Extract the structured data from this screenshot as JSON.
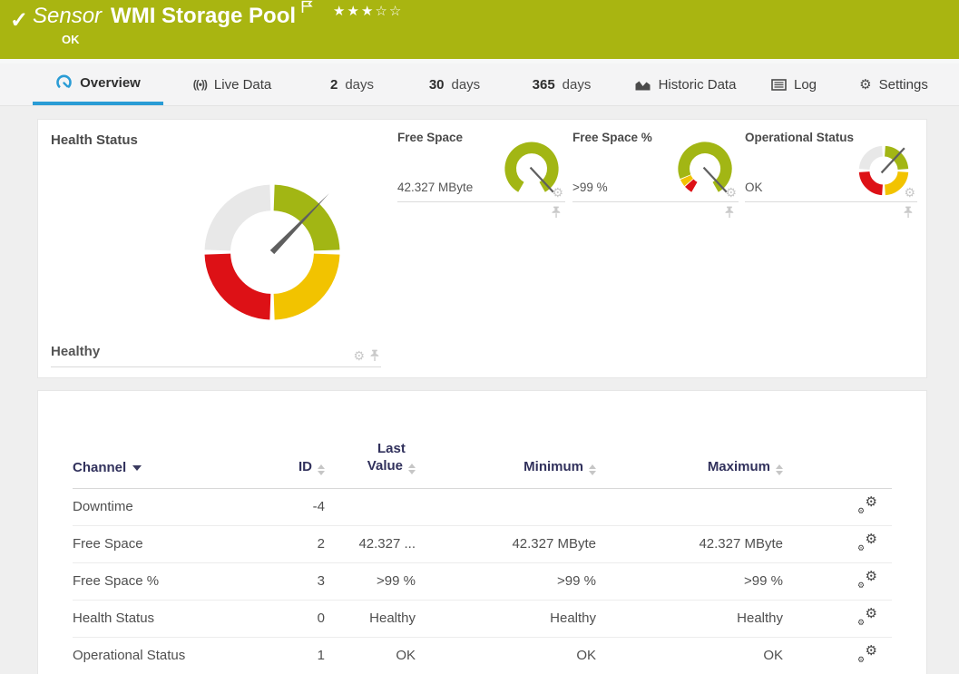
{
  "header": {
    "kind_label": "Sensor",
    "title": "WMI Storage Pool",
    "stars": "★★★☆☆",
    "status": "OK"
  },
  "tabs": [
    {
      "label": "Overview"
    },
    {
      "label": "Live Data"
    },
    {
      "num": "2",
      "label": "days"
    },
    {
      "num": "30",
      "label": "days"
    },
    {
      "num": "365",
      "label": "days"
    },
    {
      "label": "Historic Data"
    },
    {
      "label": "Log"
    },
    {
      "label": "Settings"
    }
  ],
  "gauges": {
    "health": {
      "title": "Health Status",
      "value": "Healthy"
    },
    "minis": [
      {
        "title": "Free Space",
        "value": "42.327 MByte"
      },
      {
        "title": "Free Space %",
        "value": ">99 %"
      },
      {
        "title": "Operational Status",
        "value": "OK"
      }
    ]
  },
  "table": {
    "header": {
      "channel": "Channel",
      "id": "ID",
      "last_line1": "Last",
      "last_line2": "Value",
      "minimum": "Minimum",
      "maximum": "Maximum"
    },
    "rows": [
      {
        "channel": "Downtime",
        "id": "-4",
        "last": "",
        "min": "",
        "max": ""
      },
      {
        "channel": "Free Space",
        "id": "2",
        "last": "42.327 ...",
        "min": "42.327 MByte",
        "max": "42.327 MByte"
      },
      {
        "channel": "Free Space %",
        "id": "3",
        "last": ">99 %",
        "min": ">99 %",
        "max": ">99 %"
      },
      {
        "channel": "Health Status",
        "id": "0",
        "last": "Healthy",
        "min": "Healthy",
        "max": "Healthy"
      },
      {
        "channel": "Operational Status",
        "id": "1",
        "last": "OK",
        "min": "OK",
        "max": "OK"
      }
    ]
  },
  "colors": {
    "header_green": "#a9b511",
    "gauge_green": "#a2b614",
    "gauge_yellow": "#f2c300",
    "gauge_red": "#dd1116",
    "gauge_gray": "#e8e8e8",
    "needle_gray": "#5f5f5f",
    "accent_blue": "#2a9cd5"
  }
}
